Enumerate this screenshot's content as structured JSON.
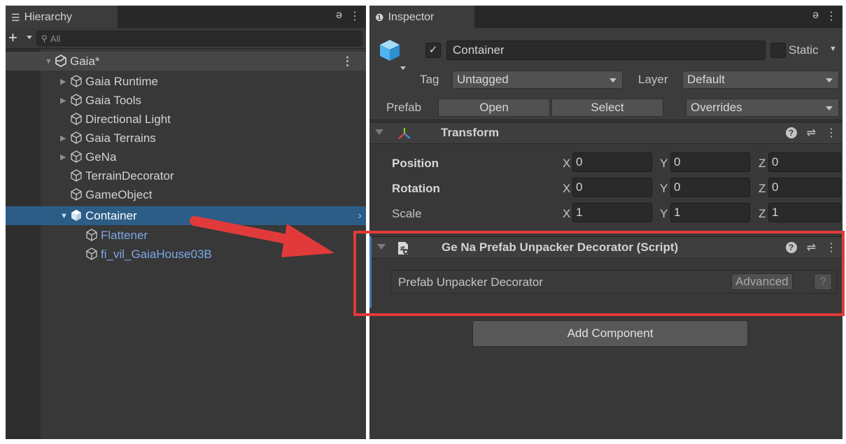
{
  "hierarchy": {
    "tab_title": "Hierarchy",
    "search_placeholder": "All",
    "scene": "Gaia*",
    "items": [
      {
        "label": "Gaia Runtime",
        "expandable": true,
        "depth": 1,
        "prefab": false
      },
      {
        "label": "Gaia Tools",
        "expandable": true,
        "depth": 1,
        "prefab": false
      },
      {
        "label": "Directional Light",
        "expandable": false,
        "depth": 1,
        "prefab": false
      },
      {
        "label": "Gaia Terrains",
        "expandable": true,
        "depth": 1,
        "prefab": false
      },
      {
        "label": "GeNa",
        "expandable": true,
        "depth": 1,
        "prefab": false
      },
      {
        "label": "TerrainDecorator",
        "expandable": false,
        "depth": 1,
        "prefab": false
      },
      {
        "label": "GameObject",
        "expandable": false,
        "depth": 1,
        "prefab": false
      },
      {
        "label": "Container",
        "expandable": true,
        "depth": 1,
        "prefab": true,
        "selected": true
      },
      {
        "label": "Flattener",
        "expandable": false,
        "depth": 2,
        "prefab": false,
        "color": "blue"
      },
      {
        "label": "fi_vil_GaiaHouse03B",
        "expandable": false,
        "depth": 2,
        "prefab": false,
        "color": "blue"
      }
    ]
  },
  "inspector": {
    "tab_title": "Inspector",
    "object_name": "Container",
    "active_check": "✓",
    "static_label": "Static",
    "tag_label": "Tag",
    "tag_value": "Untagged",
    "layer_label": "Layer",
    "layer_value": "Default",
    "prefab_label": "Prefab",
    "prefab_open": "Open",
    "prefab_select": "Select",
    "prefab_overrides": "Overrides",
    "transform": {
      "title": "Transform",
      "rows": [
        {
          "label": "Position",
          "x": "0",
          "y": "0",
          "z": "0"
        },
        {
          "label": "Rotation",
          "x": "0",
          "y": "0",
          "z": "0"
        },
        {
          "label": "Scale",
          "x": "1",
          "y": "1",
          "z": "1"
        }
      ]
    },
    "script": {
      "title": "Ge Na Prefab Unpacker Decorator (Script)",
      "field_label": "Prefab Unpacker Decorator",
      "advanced_label": "Advanced",
      "help_label": "?"
    },
    "add_component": "Add Component"
  },
  "axes": {
    "x": "X",
    "y": "Y",
    "z": "Z"
  },
  "colors": {
    "selection": "#2c5d87",
    "prefab_blue": "#7aa8e8",
    "highlight_red": "#e23a3a",
    "script_accent": "#3a79bb"
  }
}
